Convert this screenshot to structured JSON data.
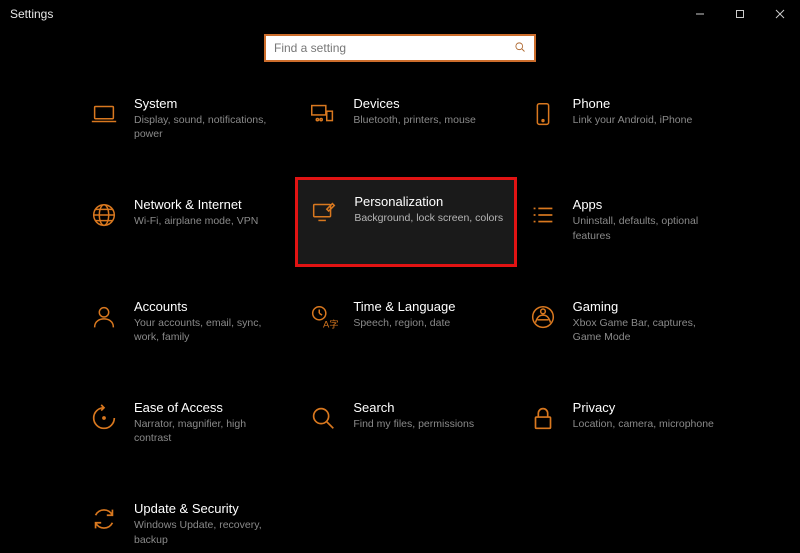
{
  "window": {
    "title": "Settings"
  },
  "search": {
    "placeholder": "Find a setting"
  },
  "tiles": {
    "system": {
      "title": "System",
      "sub": "Display, sound, notifications, power"
    },
    "devices": {
      "title": "Devices",
      "sub": "Bluetooth, printers, mouse"
    },
    "phone": {
      "title": "Phone",
      "sub": "Link your Android, iPhone"
    },
    "network": {
      "title": "Network & Internet",
      "sub": "Wi-Fi, airplane mode, VPN"
    },
    "personalization": {
      "title": "Personalization",
      "sub": "Background, lock screen, colors"
    },
    "apps": {
      "title": "Apps",
      "sub": "Uninstall, defaults, optional features"
    },
    "accounts": {
      "title": "Accounts",
      "sub": "Your accounts, email, sync, work, family"
    },
    "time": {
      "title": "Time & Language",
      "sub": "Speech, region, date"
    },
    "gaming": {
      "title": "Gaming",
      "sub": "Xbox Game Bar, captures, Game Mode"
    },
    "ease": {
      "title": "Ease of Access",
      "sub": "Narrator, magnifier, high contrast"
    },
    "searchTile": {
      "title": "Search",
      "sub": "Find my files, permissions"
    },
    "privacy": {
      "title": "Privacy",
      "sub": "Location, camera, microphone"
    },
    "update": {
      "title": "Update & Security",
      "sub": "Windows Update, recovery, backup"
    }
  }
}
